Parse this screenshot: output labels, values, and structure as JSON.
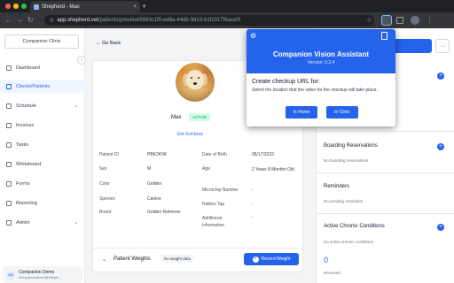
{
  "browser": {
    "tab_title": "Shepherd - Max",
    "tab_close": "×",
    "new_tab": "+",
    "url_host": "app.shepherd.vet",
    "url_path": "/patients/preview/5993c1f0-ed8a-44db-9d13-b1fc017f6ace/0"
  },
  "sidebar": {
    "clinic": "Companion Clinic",
    "collapse": "‹",
    "items": [
      {
        "label": "Dashboard"
      },
      {
        "label": "Clients/Patients"
      },
      {
        "label": "Schedule",
        "chev": "⌄"
      },
      {
        "label": "Invoices"
      },
      {
        "label": "Tasks"
      },
      {
        "label": "Whiteboard"
      },
      {
        "label": "Forms"
      },
      {
        "label": "Reporting"
      },
      {
        "label": "Admin",
        "chev": "⌄"
      }
    ],
    "user": {
      "initials": "CD",
      "name": "Companion Demo",
      "email": "companiondemo@sheph..."
    }
  },
  "main": {
    "go_back": "Go Back",
    "patient": {
      "name": "Max",
      "status": "ACTIVE",
      "owner": "Eric Erickson",
      "fields_left": [
        {
          "label": "Patient ID",
          "value": "PBK2K5K"
        },
        {
          "label": "Sex",
          "value": "M"
        },
        {
          "label": "Color",
          "value": "Golden"
        },
        {
          "label": "Species",
          "value": "Canine"
        },
        {
          "label": "Breed",
          "value": "Golden Retriever"
        }
      ],
      "fields_right": [
        {
          "label": "Date of Birth",
          "value": "05/17/2022"
        },
        {
          "label": "Age",
          "value": "2 Years 8 Months Old"
        },
        {
          "label": "Microchip Number",
          "value": "-"
        },
        {
          "label": "Rabies Tag",
          "value": "-"
        },
        {
          "label": "Additional Information",
          "value": "-"
        }
      ]
    },
    "weights": {
      "title": "Patient Weights",
      "pill": "No weight data",
      "button": "Record Weight"
    }
  },
  "right": {
    "more": "···",
    "sections": [
      {
        "title": "Boarding Reservations",
        "empty": "No boarding reservations"
      },
      {
        "title": "Reminders",
        "empty": "No pending reminders"
      },
      {
        "title": "Active Chronic Conditions",
        "empty": "No active chronic conditions"
      }
    ],
    "resolved_count": "0",
    "resolved_label": "Resolved"
  },
  "popup": {
    "title": "Companion Vision Assistant",
    "version": "Version: 0.2.4",
    "heading": "Create checkup URL for:",
    "description": "Select the location that the video for the checkup will take place.",
    "in_home": "In Home",
    "in_clinic": "In Clinic"
  },
  "colors": {
    "accent": "#2563eb",
    "active_badge": "#059669"
  }
}
